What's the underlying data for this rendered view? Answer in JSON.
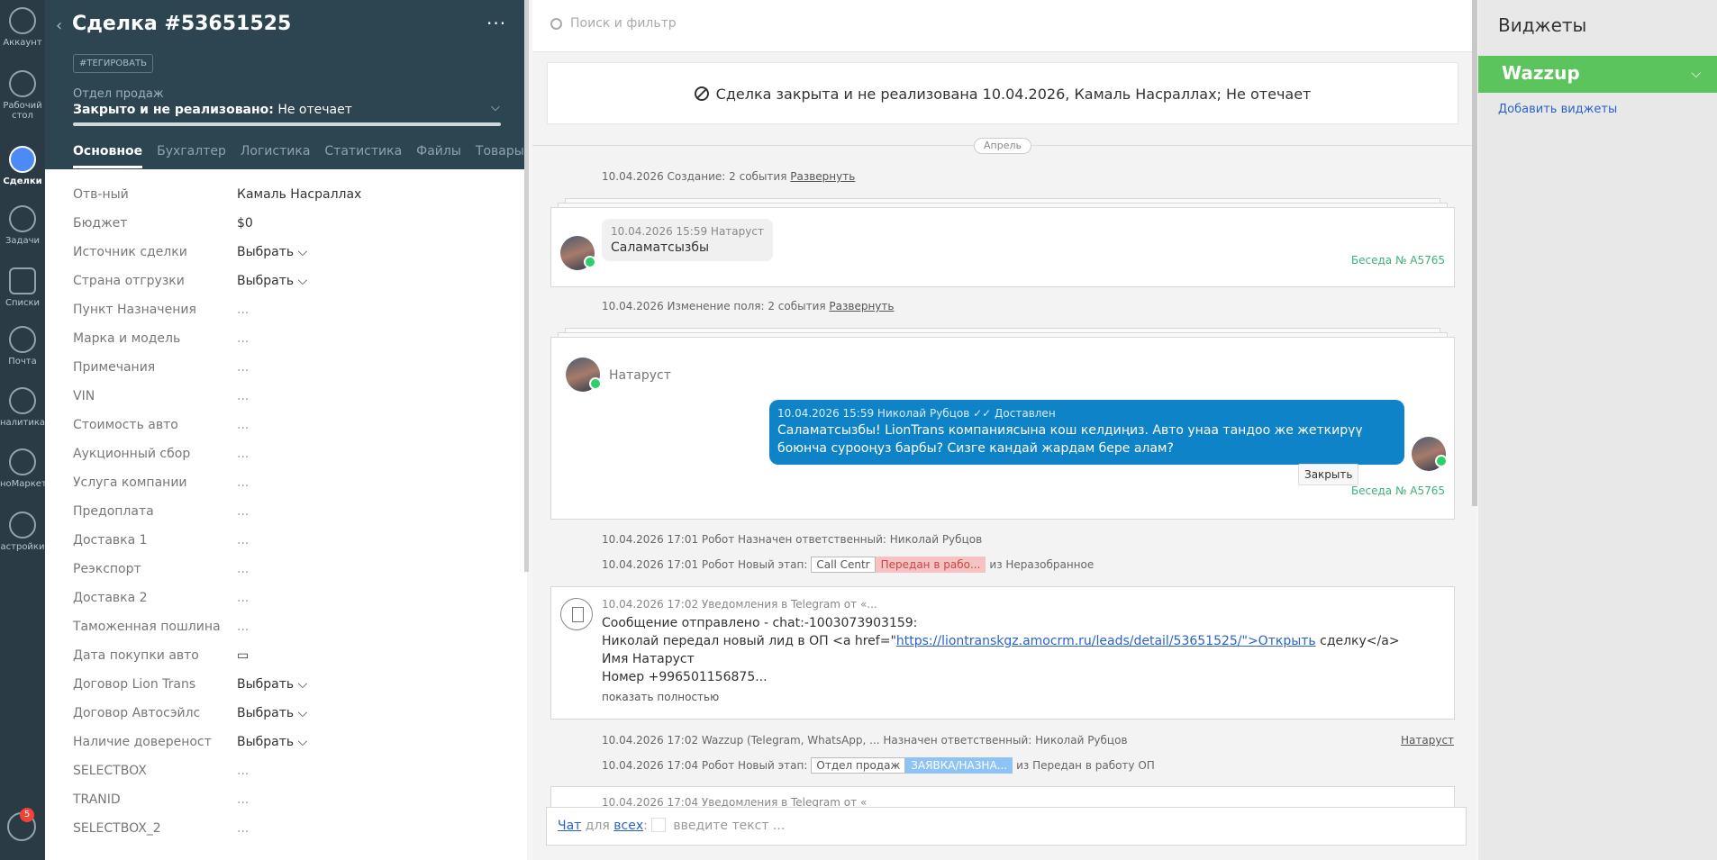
{
  "nav": {
    "items": [
      {
        "label": "Аккаунт"
      },
      {
        "label": "Рабочий стол"
      },
      {
        "label": "Сделки"
      },
      {
        "label": "Задачи"
      },
      {
        "label": "Списки"
      },
      {
        "label": "Почта"
      },
      {
        "label": "налитика"
      },
      {
        "label": "ноМаркет"
      },
      {
        "label": "астройки"
      }
    ],
    "notifications_badge": "5"
  },
  "deal": {
    "title": "Сделка #53651525",
    "more": "···",
    "tag_button": "#ТЕГИРОВАТЬ",
    "pipeline_label": "Отдел продаж",
    "status_bold": "Закрыто и не реализовано:",
    "status_reason": " Не отечает",
    "tabs": [
      "Основное",
      "Бухгалтер",
      "Логистика",
      "Статистика",
      "Файлы",
      "Товары",
      "···"
    ],
    "fields": [
      {
        "label": "Отв-ный",
        "value": "Камаль Насраллах"
      },
      {
        "label": "Бюджет",
        "value": "$0"
      },
      {
        "label": "Источник сделки",
        "value": "Выбрать ⌵"
      },
      {
        "label": "Страна отгрузки",
        "value": "Выбрать ⌵"
      },
      {
        "label": "Пункт Назначения",
        "value": "..."
      },
      {
        "label": "Марка и модель",
        "value": "..."
      },
      {
        "label": "Примечания",
        "value": "..."
      },
      {
        "label": "VIN",
        "value": "..."
      },
      {
        "label": "Стоимость авто",
        "value": "..."
      },
      {
        "label": "Аукционный сбор",
        "value": "..."
      },
      {
        "label": "Услуга компании",
        "value": "..."
      },
      {
        "label": "Предоплата",
        "value": "..."
      },
      {
        "label": "Доставка 1",
        "value": "..."
      },
      {
        "label": "Реэкспорт",
        "value": "..."
      },
      {
        "label": "Доставка 2",
        "value": "..."
      },
      {
        "label": "Таможенная пошлина",
        "value": "..."
      },
      {
        "label": "Дата покупки авто",
        "value": "▭"
      },
      {
        "label": "Договор Lion Trans",
        "value": "Выбрать ⌵"
      },
      {
        "label": "Договор Автосэйлс",
        "value": "Выбрать ⌵"
      },
      {
        "label": "Наличие довереност",
        "value": "Выбрать ⌵"
      },
      {
        "label": "SELECTBOX",
        "value": "..."
      },
      {
        "label": "TRANID",
        "value": "..."
      },
      {
        "label": "SELECTBOX_2",
        "value": "..."
      }
    ]
  },
  "feed": {
    "search_placeholder": "Поиск и фильтр",
    "closed_banner": "Сделка закрыта и не реализована 10.04.2026, Камаль Насраллах; Не отечает",
    "month": "Апрель",
    "create_note": "10.04.2026 Создание: 2 события ",
    "expand": "Развернуть",
    "msg1": {
      "meta": "10.04.2026 15:59 Натаруст",
      "text": "Саламатсызбы",
      "conv": "Беседа № А5765"
    },
    "change_note": "10.04.2026 Изменение поля: 2 события ",
    "chat": {
      "contact": "Натаруст",
      "meta": "10.04.2026 15:59 Николай Рубцов",
      "delivered": " ✓✓ Доставлен",
      "text": "Саламатсызбы! LionTrans компаниясына кош келдиңиз. Авто унаа тандоо же жеткирүү боюнча суроoңуз барбы? Сизге кандай жардам бере алам?",
      "close": "Закрыть",
      "conv": "Беседа № А5765"
    },
    "robot1": "10.04.2026 17:01 Робот Назначен ответственный: Николай Рубцов",
    "robot2_prefix": "10.04.2026 17:01 Робот Новый этап:",
    "robot2_stage_a": "Call Centr",
    "robot2_stage_b": "Передан в рабо...",
    "robot2_from": "из Неразобранное",
    "tg": {
      "meta": "10.04.2026 17:02 Уведомления в Telegram от «...",
      "line1": "Сообщение отправлено - chat:-1003073903159:",
      "line2_pre": "Николай передал новый лид в ОП <a href=\"",
      "line2_link": "https://liontranskgz.amocrm.ru/leads/detail/53651525/\">Открыть",
      "line2_post": " сделку</a>",
      "line3": "Имя Натаруст",
      "line4": "Номер +996501156875...",
      "more": "показать полностью"
    },
    "wazzup_note": "10.04.2026 17:02 Wazzup (Telegram, WhatsApp, ... Назначен ответственный: Николай Рубцов",
    "wazzup_contact": "Натаруст",
    "robot3_prefix": "10.04.2026 17:04 Робот Новый этап:",
    "robot3_stage_a": "Отдел продаж",
    "robot3_stage_b": "ЗАЯВКА/НАЗНА...",
    "robot3_from": "из Передан в работу ОП",
    "tg2_meta": "10.04.2026 17:04 Уведомления в Telegram от «",
    "composer": {
      "chat": "Чат",
      "for": " для ",
      "all": "всех",
      "colon": ":",
      "placeholder": " введите текст ..."
    }
  },
  "widgets": {
    "title": "Виджеты",
    "wazzup": "Wazzup",
    "add": "Добавить виджеты"
  },
  "colors": {
    "nav_bg": "#2b3b46",
    "header_bg": "#2d4451",
    "wazzup": "#5cc45c",
    "outgoing": "#0f83c8",
    "stage_red": "#f6c3c3",
    "stage_blue": "#8fc2f5"
  }
}
